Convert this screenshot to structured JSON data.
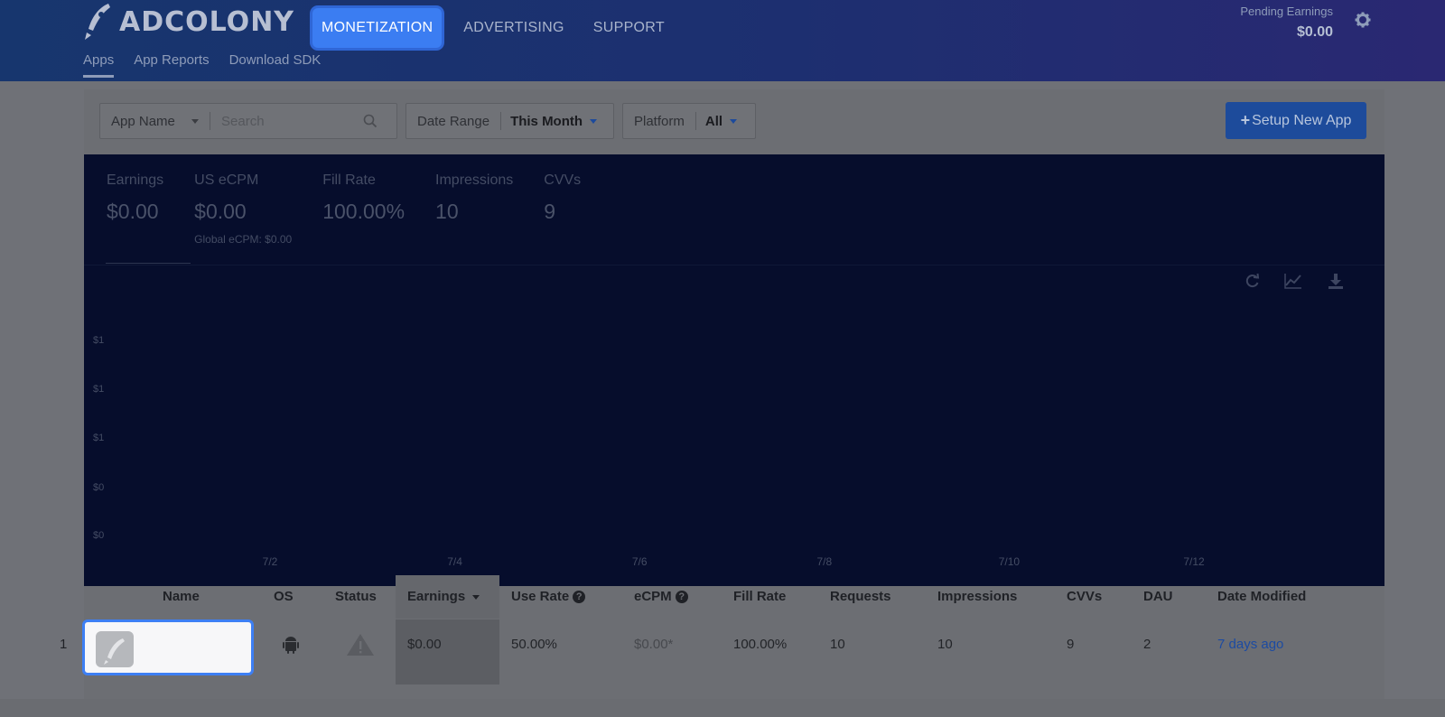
{
  "header": {
    "brand": "ADCOLONY",
    "nav": [
      "MONETIZATION",
      "ADVERTISING",
      "SUPPORT"
    ],
    "subnav": [
      "Apps",
      "App Reports",
      "Download SDK"
    ],
    "pending_label": "Pending Earnings",
    "pending_value": "$0.00"
  },
  "filters": {
    "app_name": "App Name",
    "search_placeholder": "Search",
    "date_range_label": "Date Range",
    "date_range_value": "This Month",
    "platform_label": "Platform",
    "platform_value": "All",
    "setup_button": "Setup New App"
  },
  "stats": [
    {
      "label": "Earnings",
      "value": "$0.00",
      "sub": ""
    },
    {
      "label": "US eCPM",
      "value": "$0.00",
      "sub": "Global eCPM: $0.00"
    },
    {
      "label": "Fill Rate",
      "value": "100.00%",
      "sub": ""
    },
    {
      "label": "Impressions",
      "value": "10",
      "sub": ""
    },
    {
      "label": "CVVs",
      "value": "9",
      "sub": ""
    }
  ],
  "chart_data": {
    "type": "line",
    "y_tick_labels": [
      "$1",
      "$1",
      "$1",
      "$0",
      "$0"
    ],
    "x_tick_labels": [
      "7/2",
      "7/4",
      "7/6",
      "7/8",
      "7/10",
      "7/12"
    ],
    "series": []
  },
  "table": {
    "columns": [
      "Name",
      "OS",
      "Status",
      "Earnings",
      "Use Rate",
      "eCPM",
      "Fill Rate",
      "Requests",
      "Impressions",
      "CVVs",
      "DAU",
      "Date Modified"
    ],
    "rows": [
      {
        "num": "1",
        "name": "",
        "earnings": "$0.00",
        "use_rate": "50.00%",
        "ecpm": "$0.00*",
        "fill_rate": "100.00%",
        "requests": "10",
        "impressions": "10",
        "cvvs": "9",
        "dau": "2",
        "date_modified": "7 days ago"
      }
    ]
  },
  "colors": {
    "accent": "#3b7df2",
    "header": "#17366e",
    "chart_bg": "#060d2c",
    "link": "#1c4ba2"
  }
}
